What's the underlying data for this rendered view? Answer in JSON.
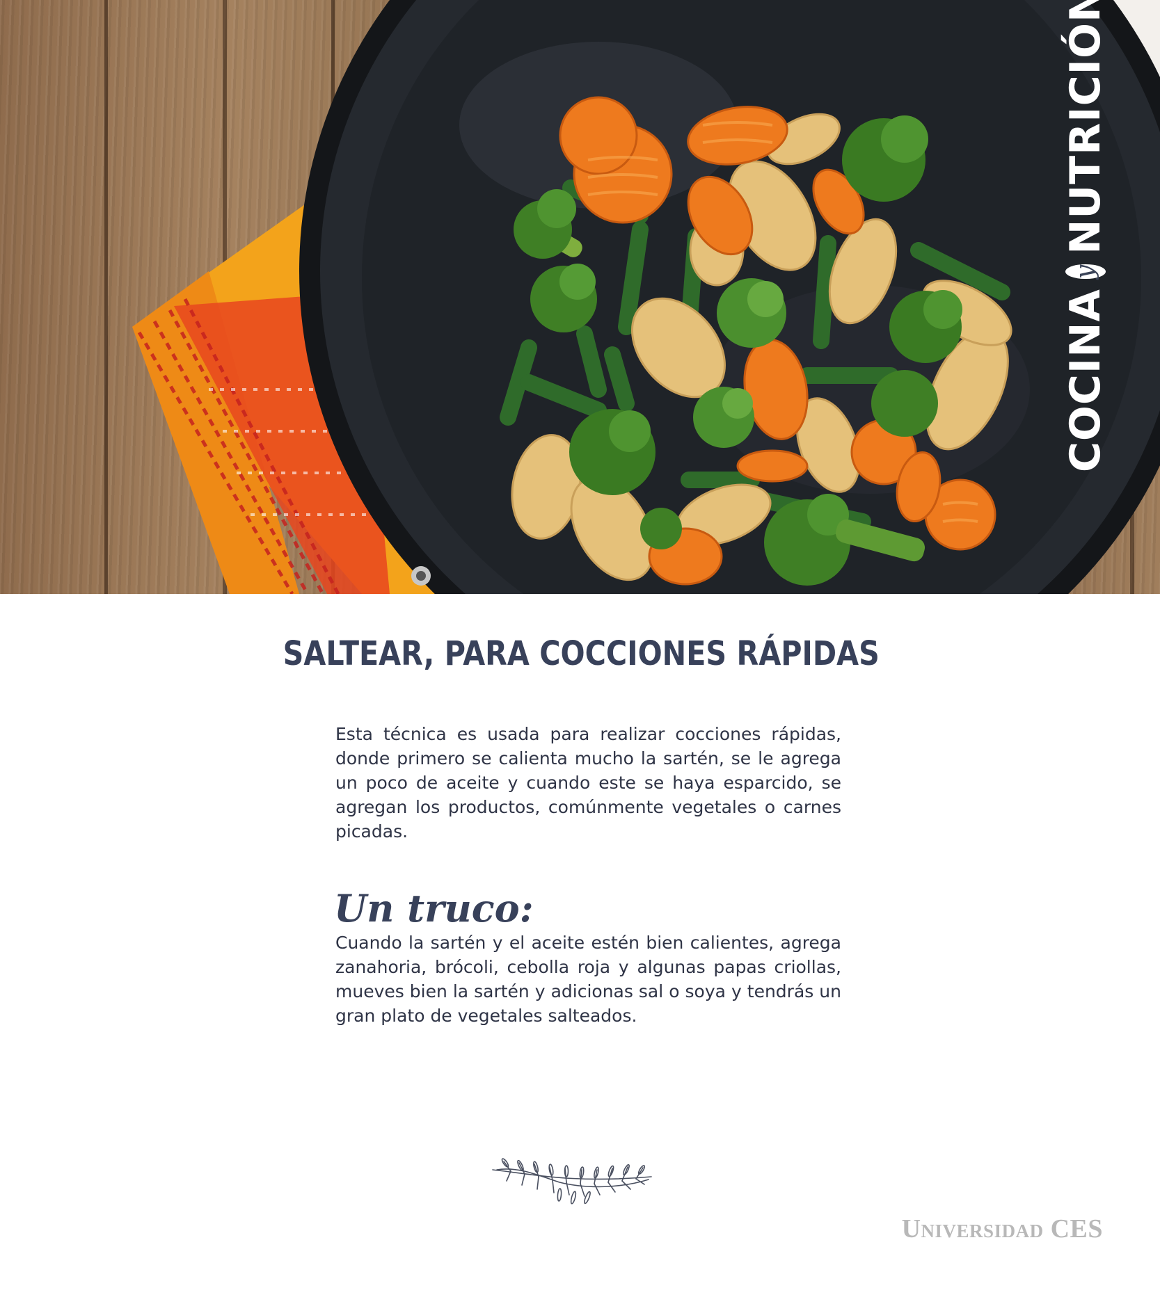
{
  "hero": {
    "image_description_icon": "stir-fry-pan-image",
    "vertical_title_left": "Cocina",
    "vertical_title_mid": "y",
    "vertical_title_right": "Nutrición"
  },
  "article": {
    "heading": "Saltear, para cocciones rápidas",
    "paragraph": "Esta técnica es usada para realizar cocciones rápidas, donde primero se calienta mucho la sartén, se le agrega un poco de aceite y cuando este se haya esparcido, se agregan los productos, comúnmente vegetales o carnes picadas.",
    "tip_title": "Un truco:",
    "tip_text": "Cuando la sartén y el aceite estén bien calientes, agrega zanahoria, brócoli, cebolla roja y algunas papas criollas, mueves bien la sartén y adicionas sal o soya y tendrás un gran plato de vegetales salteados."
  },
  "footer": {
    "decoration_icon": "rosemary-sprig-icon",
    "brand": "Universidad CES"
  },
  "colors": {
    "ink": "#38415a",
    "body": "#2f3446",
    "brand_gray": "#b8b8b8",
    "pan": "#1f2328",
    "napkin": "#f2a21c"
  }
}
